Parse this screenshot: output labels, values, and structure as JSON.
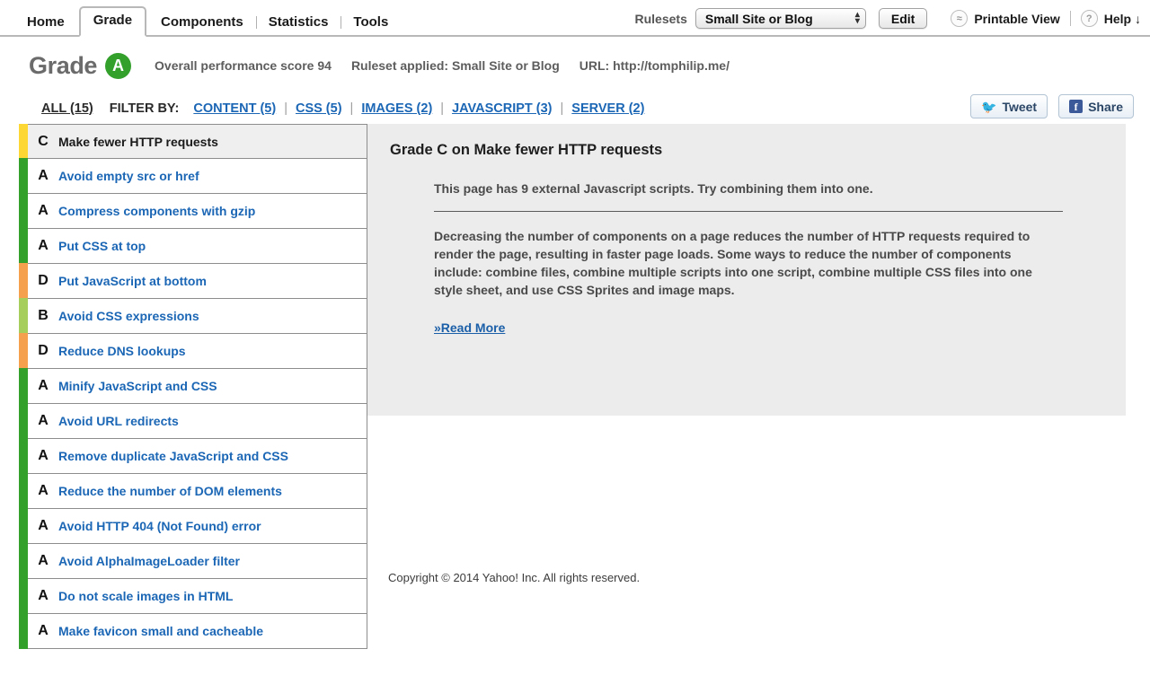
{
  "nav": {
    "tabs": [
      {
        "label": "Home",
        "active": false
      },
      {
        "label": "Grade",
        "active": true
      },
      {
        "label": "Components",
        "active": false
      },
      {
        "label": "Statistics",
        "active": false
      },
      {
        "label": "Tools",
        "active": false
      }
    ]
  },
  "header": {
    "rulesets_label": "Rulesets",
    "ruleset_selected": "Small Site or Blog",
    "ruleset_options": [
      "Small Site or Blog"
    ],
    "edit_label": "Edit",
    "printable_icon": "≈",
    "printable_label": "Printable View",
    "help_icon": "?",
    "help_label": "Help ↓"
  },
  "grade": {
    "word": "Grade",
    "letter": "A",
    "badge_color": "#33a02c",
    "score_text": "Overall performance score 94",
    "ruleset_text": "Ruleset applied: Small Site or Blog",
    "url_text": "URL: http://tomphilip.me/"
  },
  "filters": {
    "all_label": "ALL (15)",
    "filter_by_label": "FILTER BY:",
    "items": [
      {
        "label": "CONTENT (5)"
      },
      {
        "label": "CSS (5)"
      },
      {
        "label": "IMAGES (2)"
      },
      {
        "label": "JAVASCRIPT (3)"
      },
      {
        "label": "SERVER (2)"
      }
    ],
    "separator": "|"
  },
  "social": {
    "tweet_label": "Tweet",
    "tweet_icon": "twitter-bird",
    "share_label": "Share",
    "share_icon": "facebook-f"
  },
  "grade_colors": {
    "A": "#33a02c",
    "B": "#a6ce5a",
    "C": "#fdd835",
    "D": "#f5a04c",
    "F": "#e05a3a"
  },
  "rules": [
    {
      "grade": "C",
      "title": "Make fewer HTTP requests",
      "color": "#fdd835",
      "selected": true
    },
    {
      "grade": "A",
      "title": "Avoid empty src or href",
      "color": "#33a02c",
      "selected": false
    },
    {
      "grade": "A",
      "title": "Compress components with gzip",
      "color": "#33a02c",
      "selected": false
    },
    {
      "grade": "A",
      "title": "Put CSS at top",
      "color": "#33a02c",
      "selected": false
    },
    {
      "grade": "D",
      "title": "Put JavaScript at bottom",
      "color": "#f5a04c",
      "selected": false
    },
    {
      "grade": "B",
      "title": "Avoid CSS expressions",
      "color": "#a6ce5a",
      "selected": false
    },
    {
      "grade": "D",
      "title": "Reduce DNS lookups",
      "color": "#f5a04c",
      "selected": false
    },
    {
      "grade": "A",
      "title": "Minify JavaScript and CSS",
      "color": "#33a02c",
      "selected": false
    },
    {
      "grade": "A",
      "title": "Avoid URL redirects",
      "color": "#33a02c",
      "selected": false
    },
    {
      "grade": "A",
      "title": "Remove duplicate JavaScript and CSS",
      "color": "#33a02c",
      "selected": false
    },
    {
      "grade": "A",
      "title": "Reduce the number of DOM elements",
      "color": "#33a02c",
      "selected": false
    },
    {
      "grade": "A",
      "title": "Avoid HTTP 404 (Not Found) error",
      "color": "#33a02c",
      "selected": false
    },
    {
      "grade": "A",
      "title": "Avoid AlphaImageLoader filter",
      "color": "#33a02c",
      "selected": false
    },
    {
      "grade": "A",
      "title": "Do not scale images in HTML",
      "color": "#33a02c",
      "selected": false
    },
    {
      "grade": "A",
      "title": "Make favicon small and cacheable",
      "color": "#33a02c",
      "selected": false
    }
  ],
  "detail": {
    "heading": "Grade C on Make fewer HTTP requests",
    "summary": "This page has 9 external Javascript scripts. Try combining them into one.",
    "description": "Decreasing the number of components on a page reduces the number of HTTP requests required to render the page, resulting in faster page loads. Some ways to reduce the number of components include: combine files, combine multiple scripts into one script, combine multiple CSS files into one style sheet, and use CSS Sprites and image maps.",
    "read_more": "»Read More"
  },
  "footer": {
    "copyright": "Copyright © 2014 Yahoo! Inc. All rights reserved."
  }
}
